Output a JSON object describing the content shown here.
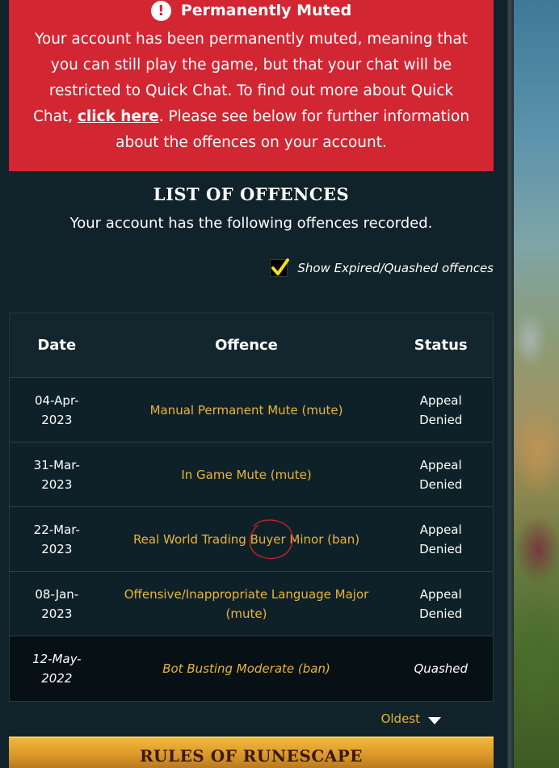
{
  "alert": {
    "icon": "exclamation-icon",
    "title": "Permanently Muted",
    "body_before": "Your account has been permanently muted, meaning that you can still play the game, but that your chat will be restricted to Quick Chat. To find out more about Quick Chat, ",
    "link_text": "click here",
    "body_after": ". Please see below for further information about the offences on your account.",
    "color": "#d22633"
  },
  "offences": {
    "title": "LIST OF OFFENCES",
    "subtitle": "Your account has the following offences recorded.",
    "toggle_label": "Show Expired/Quashed offences",
    "toggle_checked": true,
    "columns": [
      "Date",
      "Offence",
      "Status"
    ],
    "rows": [
      {
        "date_line1": "04-Apr-",
        "date_line2": "2023",
        "offence": "Manual Permanent Mute (mute)",
        "status_line1": "Appeal",
        "status_line2": "Denied"
      },
      {
        "date_line1": "31-Mar-",
        "date_line2": "2023",
        "offence": "In Game Mute (mute)",
        "status_line1": "Appeal",
        "status_line2": "Denied"
      },
      {
        "date_line1": "22-Mar-",
        "date_line2": "2023",
        "offence": "Real World Trading Buyer Minor (ban)",
        "status_line1": "Appeal",
        "status_line2": "Denied"
      },
      {
        "date_line1": "08-Jan-",
        "date_line2": "2023",
        "offence": "Offensive/Inappropriate Language Major (mute)",
        "status_line1": "Appeal",
        "status_line2": "Denied"
      },
      {
        "date_line1": "12-May-",
        "date_line2": "2022",
        "offence": "Bot Busting Moderate (ban)",
        "status_line1": "Quashed",
        "status_line2": ""
      }
    ],
    "sort_label": "Oldest",
    "accent_color": "#e9b43a"
  },
  "rules_banner": {
    "label": "RULES OF RUNESCAPE"
  }
}
